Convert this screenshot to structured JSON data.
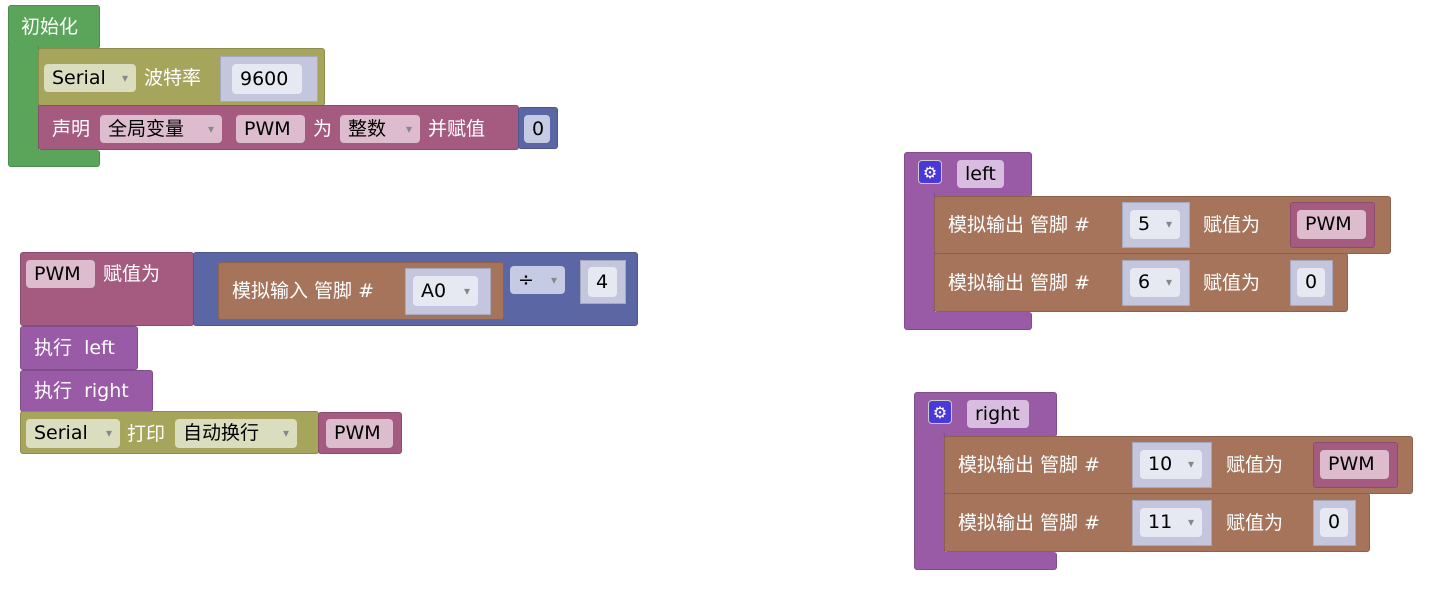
{
  "colors": {
    "setup": "#5ba55b",
    "serial": "#a5a55b",
    "variable": "#a55b80",
    "math": "#5b67a5",
    "io": "#a5745b",
    "procedure": "#995ba5"
  },
  "setup": {
    "title": "初始化",
    "serial_port": "Serial",
    "baud_label": "波特率",
    "baud": "9600",
    "declare": {
      "label": "声明",
      "scope": "全局变量",
      "name": "PWM",
      "as_label": "为",
      "type": "整数",
      "assign_label": "并赋值",
      "value": "0"
    }
  },
  "loop": {
    "var": "PWM",
    "assign_label": "赋值为",
    "analog_in": "模拟输入 管脚 #",
    "pin": "A0",
    "op": "÷",
    "divisor": "4",
    "call_left": "执行  left",
    "call_right": "执行  right",
    "print": {
      "port": "Serial",
      "label": "打印",
      "mode": "自动换行",
      "value": "PWM"
    }
  },
  "procedures": [
    {
      "name": "left",
      "icon": "gear-icon",
      "rows": [
        {
          "label": "模拟输出 管脚 #",
          "pin": "5",
          "assign": "赋值为",
          "value": "PWM"
        },
        {
          "label": "模拟输出 管脚 #",
          "pin": "6",
          "assign": "赋值为",
          "value": "0"
        }
      ]
    },
    {
      "name": "right",
      "icon": "gear-icon",
      "rows": [
        {
          "label": "模拟输出 管脚 #",
          "pin": "10",
          "assign": "赋值为",
          "value": "PWM"
        },
        {
          "label": "模拟输出 管脚 #",
          "pin": "11",
          "assign": "赋值为",
          "value": "0"
        }
      ]
    }
  ]
}
